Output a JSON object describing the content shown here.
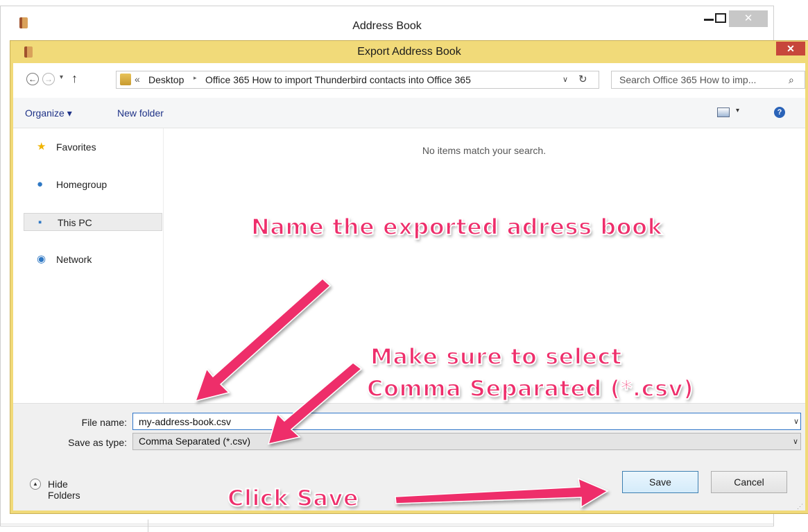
{
  "background_window": {
    "title": "Address Book",
    "close_glyph": "✕"
  },
  "dialog": {
    "title": "Export Address Book",
    "close_glyph": "✕",
    "nav": {
      "back_glyph": "←",
      "forward_glyph": "→",
      "recent_glyph": "▾",
      "up_glyph": "↑",
      "path_overflow": "«",
      "breadcrumbs": [
        "Desktop",
        "Office 365 How to import Thunderbird contacts into Office 365"
      ],
      "crumb_separator": "▸",
      "path_dropdown_glyph": "∨",
      "refresh_glyph": "↻",
      "search_placeholder": "Search Office 365 How to imp...",
      "search_glyph": "⌕"
    },
    "toolbar": {
      "organize_label": "Organize ▾",
      "new_folder_label": "New folder",
      "view_dropdown_glyph": "▾",
      "help_glyph": "?"
    },
    "sidebar": {
      "items": [
        {
          "label": "Favorites",
          "icon": "star-icon",
          "glyph": "★",
          "color": "#f0b400"
        },
        {
          "label": "Homegroup",
          "icon": "homegroup-icon",
          "glyph": "●",
          "color": "#2f78c4"
        },
        {
          "label": "This PC",
          "icon": "computer-icon",
          "glyph": "▪",
          "color": "#2f78c4"
        },
        {
          "label": "Network",
          "icon": "network-icon",
          "glyph": "◉",
          "color": "#2f78c4"
        }
      ]
    },
    "content": {
      "empty_message": "No items match your search."
    },
    "fields": {
      "file_name_label": "File name:",
      "file_name_value": "my-address-book.csv",
      "save_type_label": "Save as type:",
      "save_type_value": "Comma Separated (*.csv)",
      "dropdown_glyph": "∨"
    },
    "footer": {
      "hide_folders_glyph": "▲",
      "hide_folders_label": "Hide Folders",
      "save_label": "Save",
      "cancel_label": "Cancel",
      "grip_glyph": "⋰"
    }
  },
  "annotations": {
    "name_hint": "Name the exported adress book",
    "type_hint_line1": "Make sure to select",
    "type_hint_line2": "Comma Separated (*.csv)",
    "save_hint": "Click Save",
    "color": "#ee2e6b"
  }
}
